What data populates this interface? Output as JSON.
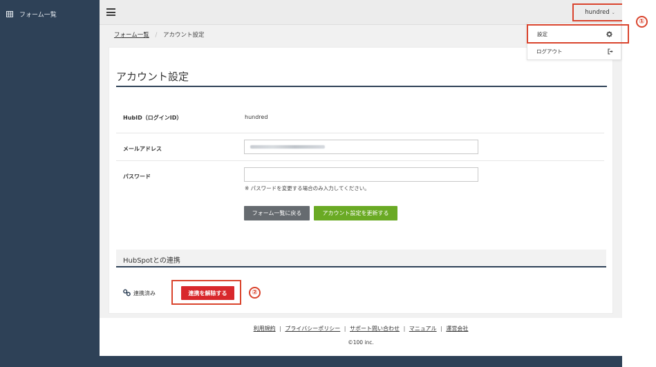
{
  "sidebar": {
    "items": [
      {
        "label": "フォーム一覧",
        "icon": "table-icon"
      }
    ]
  },
  "topbar": {
    "menu_icon": "hamburger-icon",
    "user": {
      "name": "hundred",
      "icon": "chevron-down-icon"
    }
  },
  "dropdown": {
    "items": [
      {
        "label": "設定",
        "icon": "gear-icon"
      },
      {
        "label": "ログアウト",
        "icon": "sign-out-icon"
      }
    ]
  },
  "breadcrumb": {
    "items": [
      "フォーム一覧",
      "アカウント設定"
    ],
    "separator": "/"
  },
  "account": {
    "title": "アカウント設定",
    "fields": {
      "hubid": {
        "label": "HubID（ログインID）",
        "value": "hundred"
      },
      "email": {
        "label": "メールアドレス",
        "value": ""
      },
      "password": {
        "label": "パスワード",
        "value": "",
        "note": "※ パスワードを変更する場合のみ入力してください。"
      }
    },
    "buttons": {
      "back": "フォーム一覧に戻る",
      "update": "アカウント設定を更新する"
    }
  },
  "hubspot": {
    "title": "HubSpotとの連携",
    "status": "連携済み",
    "status_icon": "link-icon",
    "unlink_button": "連携を解除する"
  },
  "annotations": {
    "badge1": "①",
    "badge2": "②"
  },
  "footer": {
    "links": [
      "利用規約",
      "プライバシーポリシー",
      "サポート問い合わせ",
      "マニュアル",
      "運営会社"
    ],
    "separator": "|",
    "copyright": "©100 inc."
  },
  "colors": {
    "sidebar": "#2e4157",
    "accent_green": "#6aaa24",
    "danger_red": "#d8282c",
    "highlight_red": "#d9432c",
    "button_gray": "#666b70"
  }
}
